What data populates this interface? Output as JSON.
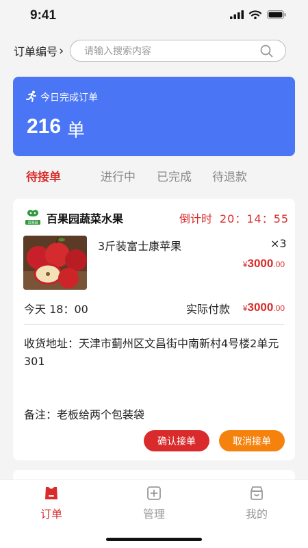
{
  "status": {
    "time": "9:41"
  },
  "search": {
    "order_no_label": "订单编号",
    "chevron": "›",
    "placeholder": "请输入搜索内容"
  },
  "summary": {
    "title": "今日完成订单",
    "count": "216",
    "unit": "单"
  },
  "tabs": [
    {
      "label": "待接单",
      "active": true
    },
    {
      "label": "进行中",
      "active": false
    },
    {
      "label": "已完成",
      "active": false
    },
    {
      "label": "待退款",
      "active": false
    }
  ],
  "order": {
    "shop_name": "百果园蔬菜水果",
    "shop_logo_text": "百果园",
    "countdown_label": "倒计时",
    "countdown_time": "20：14：55",
    "product_name": "3斤装富士康苹果",
    "product_qty": "×3",
    "product_price": {
      "symbol": "¥",
      "int": "3000",
      "dec": ".00"
    },
    "delivery_time": "今天 18：00",
    "paid_label": "实际付款",
    "paid_price": {
      "symbol": "¥",
      "int": "3000",
      "dec": ".00"
    },
    "address": "收货地址：天津市蓟州区文昌街中南新村4号楼2单元301",
    "remark": "备注：老板给两个包装袋",
    "accept_label": "确认接单",
    "cancel_label": "取消接单"
  },
  "tabbar": [
    {
      "label": "订单",
      "icon": "order-icon",
      "active": true
    },
    {
      "label": "管理",
      "icon": "manage-icon",
      "active": false
    },
    {
      "label": "我的",
      "icon": "profile-icon",
      "active": false
    }
  ],
  "colors": {
    "accent": "#d92b2b",
    "blue": "#4a76f5",
    "orange": "#f5820c"
  }
}
